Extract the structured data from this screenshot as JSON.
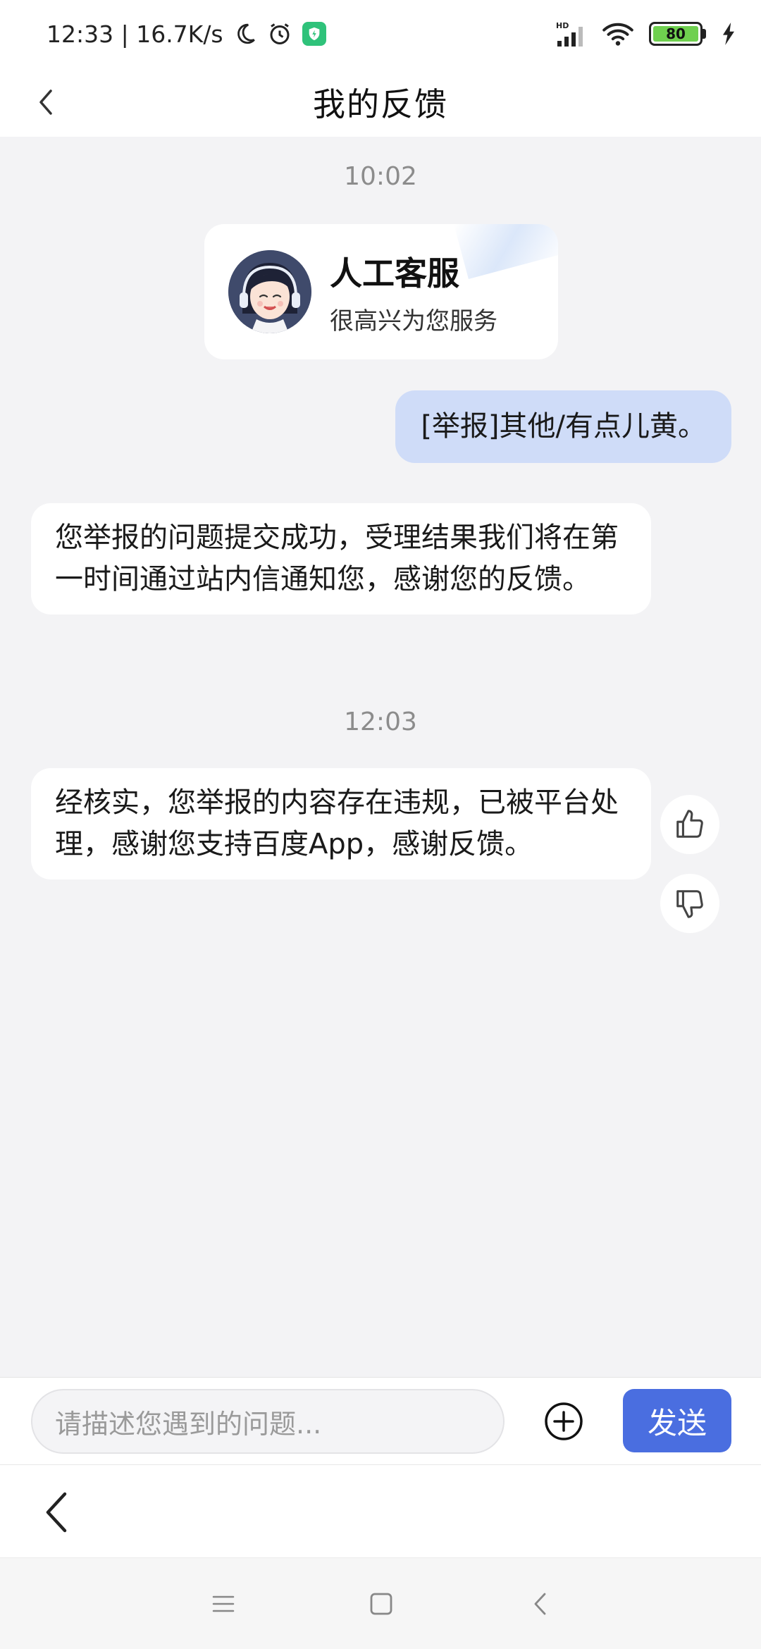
{
  "status_bar": {
    "time_speed": "12:33 | 16.7K/s",
    "network_label": "HD",
    "battery_percent": "80"
  },
  "header": {
    "title": "我的反馈"
  },
  "chat": {
    "time_1": "10:02",
    "agent_card": {
      "name": "人工客服",
      "subtitle": "很高兴为您服务"
    },
    "user_message": "[举报]其他/有点儿黄。",
    "agent_message_1": "您举报的问题提交成功，受理结果我们将在第一时间通过站内信通知您，感谢您的反馈。",
    "time_2": "12:03",
    "agent_message_2": "经核实，您举报的内容存在违规，已被平台处理，感谢您支持百度App，感谢反馈。"
  },
  "input_bar": {
    "placeholder": "请描述您遇到的问题...",
    "send_label": "发送"
  },
  "colors": {
    "accent": "#4a6ee0",
    "user_bubble": "#cfdcf8",
    "background": "#f3f3f5"
  }
}
